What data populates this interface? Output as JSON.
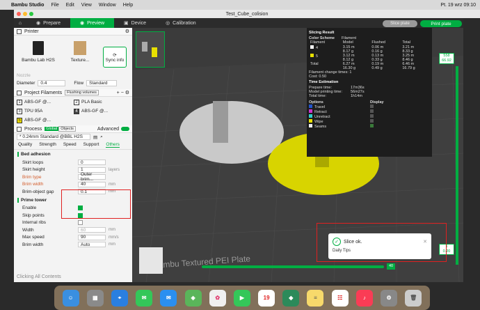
{
  "menubar": {
    "app": "Bambu Studio",
    "items": [
      "File",
      "Edit",
      "View",
      "Window",
      "Help"
    ],
    "datetime": "Pt. 19 wrz  09:10"
  },
  "window": {
    "title": "Test_Cube_colision"
  },
  "tabs": [
    {
      "label": "Prepare"
    },
    {
      "label": "Preview"
    },
    {
      "label": "Device"
    },
    {
      "label": "Calibration"
    }
  ],
  "actions": {
    "slice": "Slice plate",
    "print": "Print plate"
  },
  "printer": {
    "header": "Printer",
    "name": "Bambu Lab H2S",
    "plate": "Texture...",
    "sync": "Sync info",
    "nozzle": "Nozzle",
    "diameter_label": "Diameter",
    "diameter": "0.4",
    "flow_label": "Flow",
    "flow": "Standard"
  },
  "filaments": {
    "header": "Project Filaments",
    "flushing": "Flushing volumes",
    "items": [
      {
        "num": "1",
        "name": "ABS-GF @..."
      },
      {
        "num": "2",
        "name": "PLA Basic"
      },
      {
        "num": "3",
        "name": "TPU 95A"
      },
      {
        "num": "4",
        "name": "ABS-GF @..."
      },
      {
        "num": "5",
        "name": "ABS-GF @..."
      }
    ]
  },
  "process": {
    "header": "Process",
    "global": "Global",
    "objects": "Objects",
    "advanced": "Advanced",
    "preset": "* 0.24mm Standard @BBL H2S",
    "tabs": [
      "Quality",
      "Strength",
      "Speed",
      "Support",
      "Others"
    ],
    "bed_adhesion": "Bed adhesion",
    "rows": [
      {
        "label": "Skirt loops",
        "value": "0",
        "unit": ""
      },
      {
        "label": "Skirt height",
        "value": "1",
        "unit": "layers"
      },
      {
        "label": "Brim type",
        "value": "Outer brim...",
        "unit": ""
      },
      {
        "label": "Brim width",
        "value": "40",
        "unit": "mm"
      },
      {
        "label": "Brim-object gap",
        "value": "0.1",
        "unit": "mm"
      }
    ],
    "prime_tower": "Prime tower",
    "prime_rows": [
      {
        "label": "Enable",
        "checked": true
      },
      {
        "label": "Skip points",
        "checked": true
      },
      {
        "label": "Internal ribs",
        "checked": false
      }
    ],
    "prime_vals": [
      {
        "label": "Width",
        "value": "60",
        "unit": "mm"
      },
      {
        "label": "Max speed",
        "value": "90",
        "unit": "mm/s"
      },
      {
        "label": "Brim width",
        "value": "Auto",
        "unit": "mm"
      }
    ]
  },
  "slicing": {
    "title": "Slicing Result",
    "color_scheme": "Color Scheme",
    "scheme_val": "Filament",
    "cols": [
      "Filament",
      "Model",
      "Flushed",
      "Total"
    ],
    "rows": [
      {
        "id": "4",
        "color": "#ffffff",
        "model": "3.15 m\n8.17 g",
        "flushed": "0.06 m\n0.16 g",
        "total": "3.21 m\n8.33 g"
      },
      {
        "id": "5",
        "color": "#e8e000",
        "model": "3.12 m\n8.12 g",
        "flushed": "0.13 m\n0.33 g",
        "total": "3.25 m\n8.46 g"
      }
    ],
    "total": {
      "label": "Total",
      "model": "6.27 m\n16.30 g",
      "flushed": "0.19 m\n0.49 g",
      "total": "6.46 m\n16.79 g"
    },
    "change_times": "Filament change times:  1",
    "cost": "Cost:  0.50",
    "time_header": "Time Estimation",
    "prepare": "Prepare time:",
    "prepare_v": "17m36s",
    "model": "Model printing time:",
    "model_v": "56m27s",
    "totalt": "Total time:",
    "totalt_v": "1h14m",
    "options": "Options",
    "display": "Display",
    "opts": [
      {
        "name": "Travel",
        "color": "#2255cc"
      },
      {
        "name": "Retract",
        "color": "#cc33cc"
      },
      {
        "name": "Unretract",
        "color": "#33cccc"
      },
      {
        "name": "Wipe",
        "color": "#e8e000"
      },
      {
        "name": "Seams",
        "color": "#eeeeee"
      }
    ]
  },
  "viewport": {
    "bed_text": "Bambu Textured PEI Plate",
    "vslider_top": "558\n66.92",
    "vslider_bottom": "1\n0.20",
    "hslider_val": "40"
  },
  "notification": {
    "text": "Slice ok.",
    "daily": "Daily Tips"
  },
  "status": {
    "text": "Clicking  All Contents"
  },
  "dock": [
    "Finder",
    "Launchpad",
    "Safari",
    "Messages",
    "Mail",
    "Maps",
    "Photos",
    "FaceTime",
    "Calendar",
    "Bambu",
    "Notes",
    "Reminders",
    "Music",
    "Settings",
    "Trash"
  ]
}
